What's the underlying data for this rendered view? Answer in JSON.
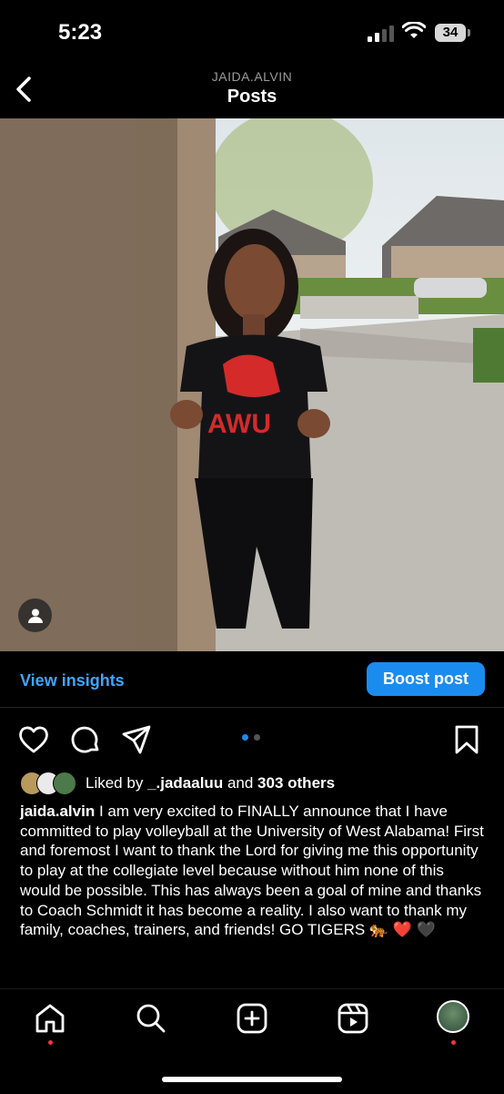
{
  "status_bar": {
    "time": "5:23",
    "battery": "34"
  },
  "header": {
    "username": "JAIDA.ALVIN",
    "title": "Posts"
  },
  "post": {
    "view_insights": "View insights",
    "boost_label": "Boost post",
    "carousel": {
      "count": 2,
      "active_index": 1
    },
    "liked_by_prefix": "Liked by",
    "liked_by_user": "_.jadaaluu",
    "liked_by_and": "and",
    "liked_by_others": "303 others",
    "caption_user": "jaida.alvin",
    "caption_text": "I am very excited to FINALLY announce that I have committed to play volleyball at the University of West Alabama! First and foremost I want to thank the Lord for giving me this opportunity to play at the collegiate level because without him none of this would be possible. This has always been a goal of mine and thanks to Coach Schmidt it has become a reality. I also want to thank my family, coaches, trainers, and friends! GO TIGERS 🐅 ❤️ 🖤",
    "shirt_text": "AWU"
  },
  "colors": {
    "accent": "#1a8cf0",
    "link": "#3ea6ff",
    "notification": "#ff3040",
    "shirt_print": "#d42a2a"
  },
  "icons": [
    "back-icon",
    "heart-icon",
    "comment-icon",
    "share-icon",
    "bookmark-icon",
    "home-icon",
    "search-icon",
    "create-icon",
    "reels-icon",
    "profile-avatar"
  ]
}
